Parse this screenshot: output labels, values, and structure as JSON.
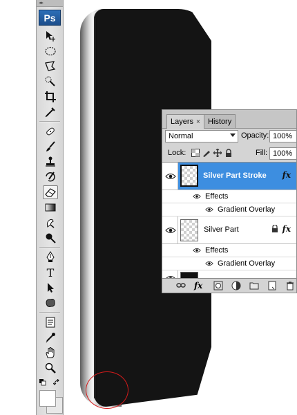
{
  "tools": {
    "app_logo": "Ps",
    "grip": "◂▸",
    "items": [
      {
        "name": "move-tool"
      },
      {
        "name": "elliptical-marquee-tool"
      },
      {
        "name": "polygonal-lasso-tool"
      },
      {
        "name": "quick-selection-tool"
      },
      {
        "name": "crop-tool"
      },
      {
        "name": "eyedropper-slice-tool"
      },
      {
        "name": "spot-healing-brush-tool"
      },
      {
        "name": "brush-tool"
      },
      {
        "name": "clone-stamp-tool"
      },
      {
        "name": "history-brush-tool"
      },
      {
        "name": "eraser-tool",
        "active": true
      },
      {
        "name": "gradient-tool"
      },
      {
        "name": "blur-tool"
      },
      {
        "name": "dodge-tool"
      },
      {
        "name": "pen-tool"
      },
      {
        "name": "type-tool"
      },
      {
        "name": "path-selection-tool"
      },
      {
        "name": "custom-shape-tool"
      },
      {
        "name": "notes-tool"
      },
      {
        "name": "eyedropper-tool"
      },
      {
        "name": "hand-tool"
      },
      {
        "name": "zoom-tool"
      }
    ],
    "foreground_color": "#ffffff",
    "background_color": "#e8e8e8"
  },
  "canvas": {
    "phone_body_color": "#141414",
    "highlight_circle_color": "#d31b1b"
  },
  "layers_panel": {
    "tabs": [
      {
        "label": "Layers",
        "active": true,
        "close": "×"
      },
      {
        "label": "History",
        "active": false
      }
    ],
    "blend_mode": "Normal",
    "opacity_label": "Opacity:",
    "opacity_value": "100%",
    "lock_label": "Lock:",
    "fill_label": "Fill:",
    "fill_value": "100%",
    "layers": [
      {
        "name": "Silver Part Stroke",
        "selected": true,
        "fx": "fx",
        "effects_label": "Effects",
        "effect": "Gradient Overlay"
      },
      {
        "name": "Silver Part",
        "selected": false,
        "locked": true,
        "fx": "fx",
        "effects_label": "Effects",
        "effect": "Gradient Overlay"
      }
    ],
    "bottom_fx": "fx",
    "selection_color": "#3d8ee0"
  }
}
